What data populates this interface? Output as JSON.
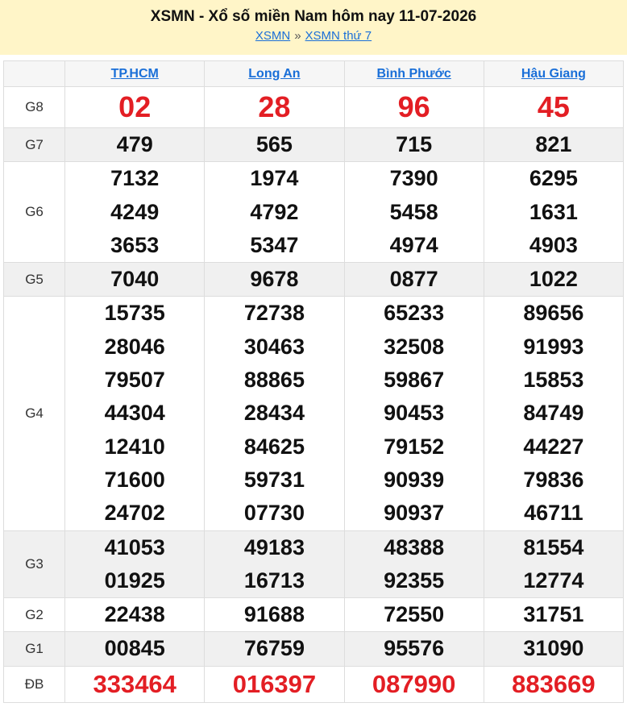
{
  "header": {
    "title": "XSMN - Xổ số miền Nam hôm nay 11-07-2026",
    "crumb_1": "XSMN",
    "crumb_sep": "»",
    "crumb_2": "XSMN thứ 7"
  },
  "provinces": [
    "TP.HCM",
    "Long An",
    "Bình Phước",
    "Hậu Giang"
  ],
  "colors": {
    "accent_link": "#1a6fd8",
    "special_red": "#e31e24",
    "header_bg": "#fff5c8",
    "alt_row_bg": "#f0f0f0"
  },
  "prizes": [
    {
      "label": "G8",
      "cols": [
        [
          "02"
        ],
        [
          "28"
        ],
        [
          "96"
        ],
        [
          "45"
        ]
      ]
    },
    {
      "label": "G7",
      "cols": [
        [
          "479"
        ],
        [
          "565"
        ],
        [
          "715"
        ],
        [
          "821"
        ]
      ]
    },
    {
      "label": "G6",
      "cols": [
        [
          "7132",
          "4249",
          "3653"
        ],
        [
          "1974",
          "4792",
          "5347"
        ],
        [
          "7390",
          "5458",
          "4974"
        ],
        [
          "6295",
          "1631",
          "4903"
        ]
      ]
    },
    {
      "label": "G5",
      "cols": [
        [
          "7040"
        ],
        [
          "9678"
        ],
        [
          "0877"
        ],
        [
          "1022"
        ]
      ]
    },
    {
      "label": "G4",
      "cols": [
        [
          "15735",
          "28046",
          "79507",
          "44304",
          "12410",
          "71600",
          "24702"
        ],
        [
          "72738",
          "30463",
          "88865",
          "28434",
          "84625",
          "59731",
          "07730"
        ],
        [
          "65233",
          "32508",
          "59867",
          "90453",
          "79152",
          "90939",
          "90937"
        ],
        [
          "89656",
          "91993",
          "15853",
          "84749",
          "44227",
          "79836",
          "46711"
        ]
      ]
    },
    {
      "label": "G3",
      "cols": [
        [
          "41053",
          "01925"
        ],
        [
          "49183",
          "16713"
        ],
        [
          "48388",
          "92355"
        ],
        [
          "81554",
          "12774"
        ]
      ]
    },
    {
      "label": "G2",
      "cols": [
        [
          "22438"
        ],
        [
          "91688"
        ],
        [
          "72550"
        ],
        [
          "31751"
        ]
      ]
    },
    {
      "label": "G1",
      "cols": [
        [
          "00845"
        ],
        [
          "76759"
        ],
        [
          "95576"
        ],
        [
          "31090"
        ]
      ]
    },
    {
      "label": "ĐB",
      "cols": [
        [
          "333464"
        ],
        [
          "016397"
        ],
        [
          "087990"
        ],
        [
          "883669"
        ]
      ]
    }
  ]
}
